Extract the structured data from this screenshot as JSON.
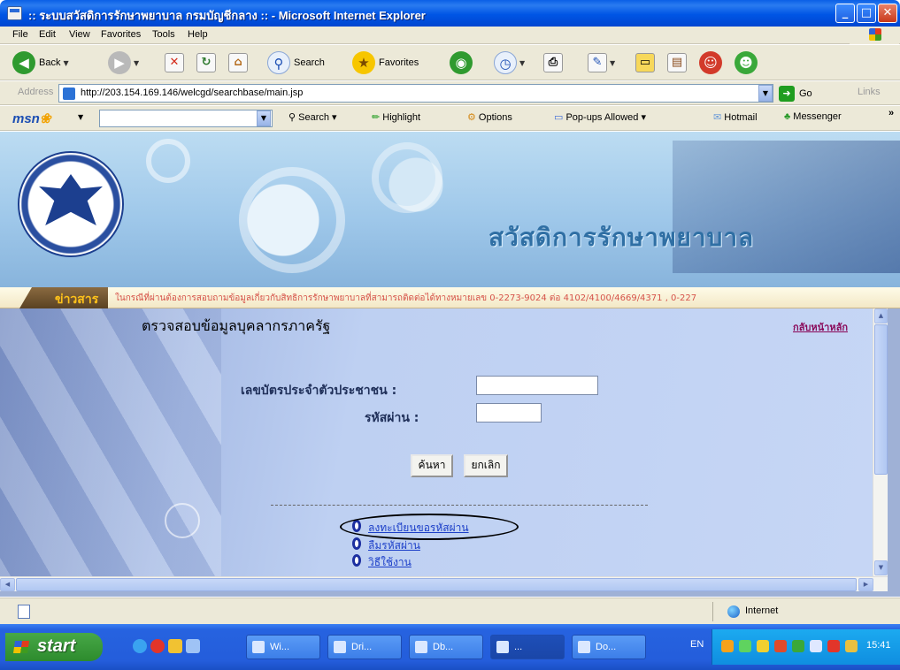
{
  "window": {
    "title": ":: ระบบสวัสดิการรักษาพยาบาล กรมบัญชีกลาง :: - Microsoft Internet Explorer",
    "minimize": "_",
    "maximize": "□",
    "close": "✕"
  },
  "menu": [
    "File",
    "Edit",
    "View",
    "Favorites",
    "Tools",
    "Help"
  ],
  "toolbar": {
    "back_label": "Back",
    "search_label": "Search",
    "favorites_label": "Favorites"
  },
  "address": {
    "label": "Address",
    "url": "http://203.154.169.146/welcgd/searchbase/main.jsp",
    "go_label": "Go",
    "links_label": "Links"
  },
  "msn": {
    "logo": "msn",
    "search_label": "Search",
    "highlight_label": "Highlight",
    "options_label": "Options",
    "popups_label": "Pop-ups Allowed",
    "hotmail_label": "Hotmail",
    "messenger_label": "Messenger"
  },
  "page": {
    "banner_title": "สวัสดิการรักษาพยาบาล",
    "news_label": "ข่าวสาร",
    "news_text": "ในกรณีที่ผ่านต้องการสอบถามข้อมูลเกี่ยวกับสิทธิการรักษาพยาบาลที่สามารถติดต่อได้ทางหมายเลข 0-2273-9024 ต่อ 4102/4100/4669/4371 , 0-227",
    "form_title": "ตรวจสอบข้อมูลบุคลากรภาครัฐ",
    "home_link": "กลับหน้าหลัก",
    "id_label": "เลขบัตรประจำตัวประชาชน :",
    "password_label": "รหัสผ่าน :",
    "id_value": "",
    "password_value": "",
    "search_button": "ค้นหา",
    "cancel_button": "ยกเลิก",
    "links": [
      "ลงทะเบียนขอรหัสผ่าน",
      "ลืมรหัสผ่าน",
      "วิธีใช้งาน"
    ]
  },
  "status": {
    "zone": "Internet"
  },
  "taskbar": {
    "start_label": "start",
    "tasks": [
      "Wi...",
      "Dri...",
      "Db...",
      "...",
      "Do..."
    ],
    "language": "EN",
    "clock": "15:41"
  }
}
